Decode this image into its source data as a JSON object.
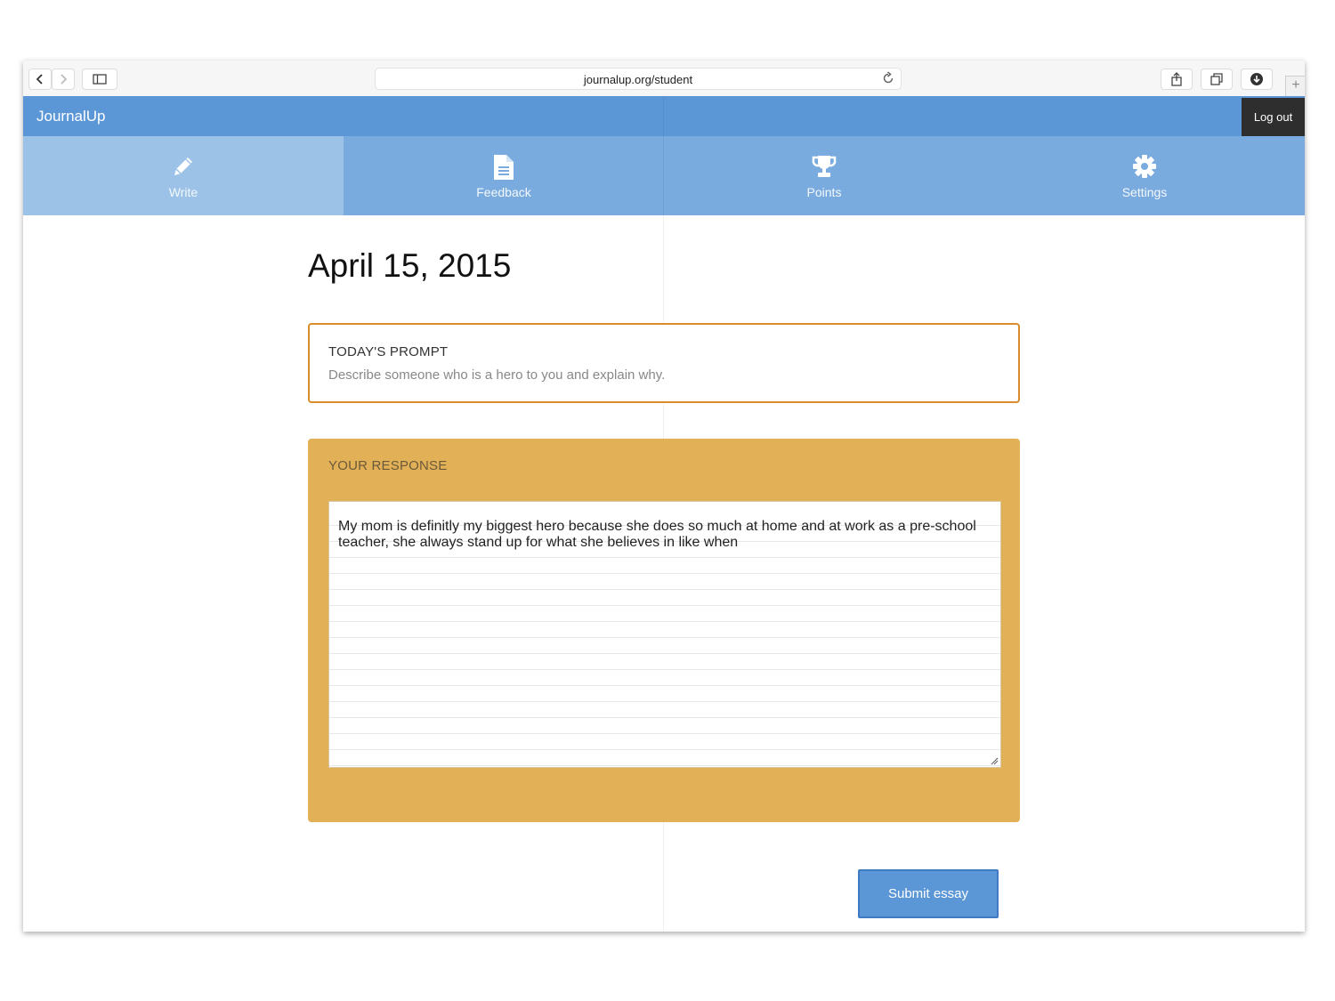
{
  "browser": {
    "url": "journalup.org/student",
    "back_icon": "chevron-left",
    "forward_icon": "chevron-right",
    "sidebar_icon": "sidebar-toggle",
    "reload_icon": "reload",
    "share_icon": "share",
    "tabs_icon": "tab-overview",
    "download_icon": "download",
    "new_tab": "+"
  },
  "app": {
    "brand": "JournalUp",
    "logout_label": "Log out",
    "header_color": "#5b96d6"
  },
  "nav": {
    "tabs": [
      {
        "label": "Write",
        "icon": "pencil",
        "active": true
      },
      {
        "label": "Feedback",
        "icon": "document",
        "active": false
      },
      {
        "label": "Points",
        "icon": "trophy",
        "active": false
      },
      {
        "label": "Settings",
        "icon": "gear",
        "active": false
      }
    ]
  },
  "main": {
    "date": "April 15, 2015",
    "prompt": {
      "heading": "TODAY'S PROMPT",
      "text": "Describe someone who is a hero to you and explain why.",
      "border_color": "#d98c2b"
    },
    "response": {
      "heading": "YOUR RESPONSE",
      "text": "My mom is definitly my biggest hero because she does so much at home and at work as a pre-school teacher, she always stand up for what she believes in like when",
      "card_color": "#e1b057"
    },
    "submit_label": "Submit essay"
  }
}
